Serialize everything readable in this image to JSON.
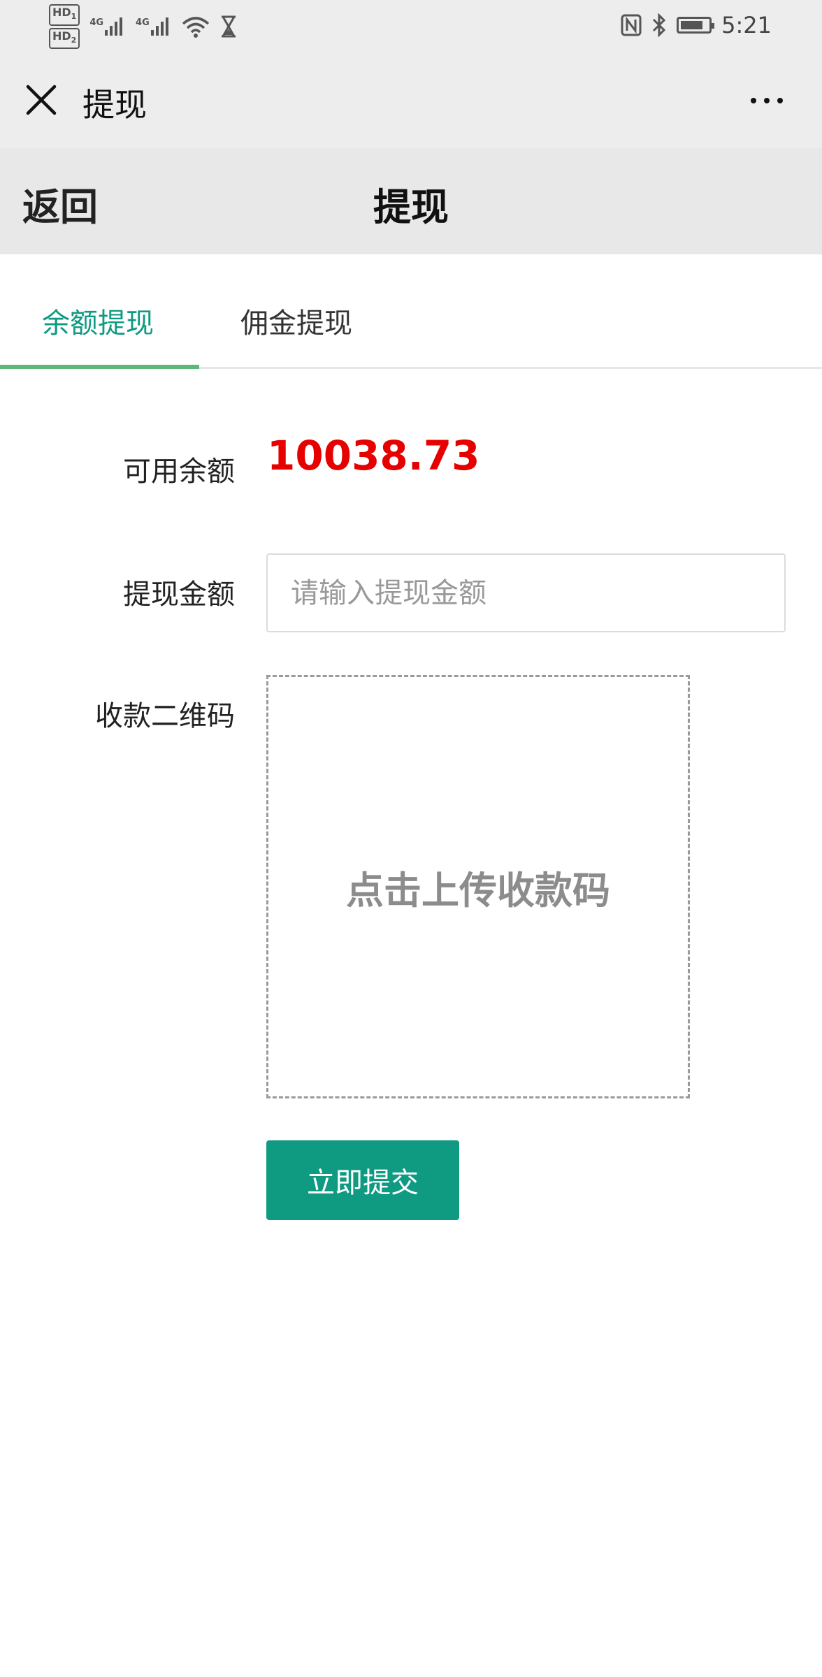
{
  "status_bar": {
    "time": "5:21",
    "hd1": "HD",
    "hd2": "HD",
    "sim1_sub": "1",
    "sim2_sub": "2",
    "net1": "4G",
    "net2": "4G",
    "icons": [
      "signal-icon",
      "wifi-icon",
      "hourglass-icon",
      "nfc-icon",
      "bluetooth-icon",
      "battery-icon"
    ]
  },
  "wechat_bar": {
    "title": "提现",
    "close_icon": "close-icon",
    "more_icon": "more-icon"
  },
  "nav": {
    "back_label": "返回",
    "title": "提现"
  },
  "tabs": [
    {
      "label": "余额提现",
      "active": true
    },
    {
      "label": "佣金提现",
      "active": false
    }
  ],
  "form": {
    "balance_label": "可用余额",
    "balance_value": "10038.73",
    "amount_label": "提现金额",
    "amount_placeholder": "请输入提现金额",
    "amount_value": "",
    "qrcode_label": "收款二维码",
    "upload_text": "点击上传收款码",
    "submit_label": "立即提交"
  },
  "colors": {
    "accent": "#0f9a82",
    "tab_underline": "#5bb878",
    "balance": "#e60000",
    "header_bg": "#ededed"
  }
}
